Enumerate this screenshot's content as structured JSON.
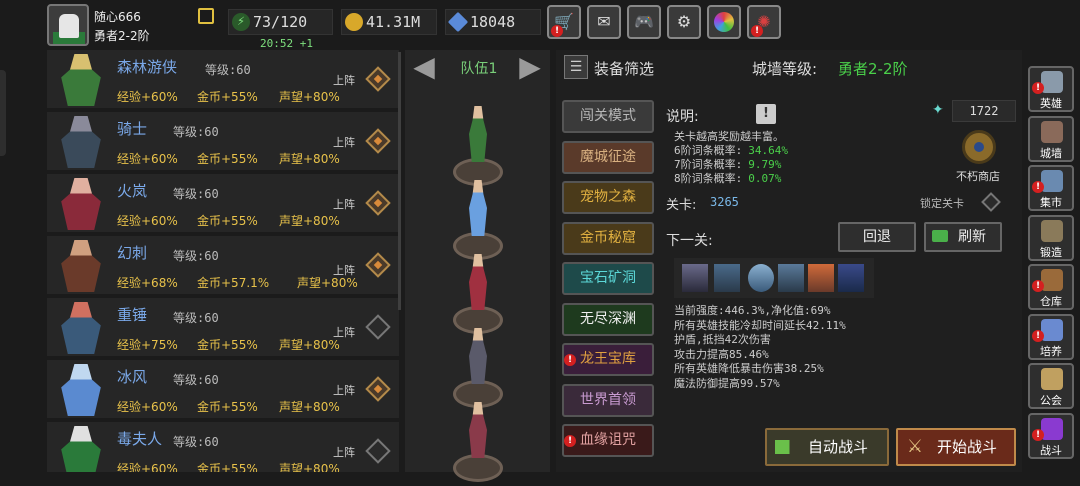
{
  "player": {
    "name": "随心666",
    "rank": "勇者2-2阶"
  },
  "resources": {
    "stamina": "73/120",
    "stamina_timer": "20:52 +1",
    "gold": "41.31M",
    "gems": "18048"
  },
  "colors": {
    "accent_green": "#4ad04a",
    "hero_name": "#7aa8e8",
    "bonus": "#e8c24a",
    "alert": "#d42020"
  },
  "top_icons": [
    "shop-cart-icon",
    "mail-icon",
    "gamepad-icon",
    "gear-icon",
    "color-wheel-icon",
    "firework-icon"
  ],
  "heroes": [
    {
      "name": "森林游侠",
      "level_label": "等级:60",
      "exp": "经验+60%",
      "gold": "金币+55%",
      "fame": "声望+80%",
      "deploy": "上阵",
      "selected": true
    },
    {
      "name": "骑士",
      "level_label": "等级:60",
      "exp": "经验+60%",
      "gold": "金币+55%",
      "fame": "声望+80%",
      "deploy": "上阵",
      "selected": true
    },
    {
      "name": "火岚",
      "level_label": "等级:60",
      "exp": "经验+60%",
      "gold": "金币+55%",
      "fame": "声望+80%",
      "deploy": "上阵",
      "selected": true
    },
    {
      "name": "幻刺",
      "level_label": "等级:60",
      "exp": "经验+68%",
      "gold": "金币+57.1%",
      "fame": "声望+80%",
      "deploy": "上阵",
      "selected": true
    },
    {
      "name": "重锤",
      "level_label": "等级:60",
      "exp": "经验+75%",
      "gold": "金币+55%",
      "fame": "声望+80%",
      "deploy": "上阵",
      "selected": false
    },
    {
      "name": "冰风",
      "level_label": "等级:60",
      "exp": "经验+60%",
      "gold": "金币+55%",
      "fame": "声望+80%",
      "deploy": "上阵",
      "selected": true
    },
    {
      "name": "毒夫人",
      "level_label": "等级:60",
      "exp": "经验+60%",
      "gold": "金币+55%",
      "fame": "声望+80%",
      "deploy": "上阵",
      "selected": false
    }
  ],
  "team": {
    "label": "队伍1"
  },
  "panel": {
    "filter_label": "装备筛选",
    "wall_label": "城墙等级:",
    "wall_value": "勇者2-2阶"
  },
  "modes": [
    {
      "label": "闯关模式",
      "style": "gray",
      "alert": false
    },
    {
      "label": "魔城征途",
      "style": "brown",
      "alert": false
    },
    {
      "label": "宠物之森",
      "style": "olive",
      "alert": false
    },
    {
      "label": "金币秘窟",
      "style": "olive",
      "alert": false
    },
    {
      "label": "宝石矿洞",
      "style": "teal",
      "alert": false
    },
    {
      "label": "无尽深渊",
      "style": "green",
      "alert": false
    },
    {
      "label": "龙王宝库",
      "style": "purple",
      "alert": true
    },
    {
      "label": "世界首领",
      "style": "violet",
      "alert": false
    },
    {
      "label": "血缘诅咒",
      "style": "red",
      "alert": true
    }
  ],
  "details": {
    "title": "说明:",
    "gem_count": "1722",
    "shop_label": "不朽商店",
    "desc": "关卡越高奖励越丰富。",
    "rates": [
      {
        "label": "6阶词条概率:",
        "value": "34.64%"
      },
      {
        "label": "7阶词条概率:",
        "value": "9.79%"
      },
      {
        "label": "8阶词条概率:",
        "value": "0.07%"
      }
    ],
    "stage_label": "关卡:",
    "stage_value": "3265",
    "lock_label": "锁定关卡",
    "next_label": "下一关:",
    "back_btn": "回退",
    "refresh_btn": "刷新",
    "effects": [
      "当前强度:446.3%,净化值:69%",
      "所有英雄技能冷却时间延长42.11%",
      "护盾,抵挡42次伤害",
      "攻击力提高85.46%",
      "所有英雄降低暴击伤害38.25%",
      "魔法防御提高99.57%"
    ],
    "auto_battle": "自动战斗",
    "start_battle": "开始战斗"
  },
  "sidebar": [
    {
      "label": "英雄",
      "icon": "helmet-icon",
      "alert": true
    },
    {
      "label": "城墙",
      "icon": "castle-icon",
      "alert": false
    },
    {
      "label": "集市",
      "icon": "market-icon",
      "alert": true
    },
    {
      "label": "锻造",
      "icon": "anvil-icon",
      "alert": false
    },
    {
      "label": "仓库",
      "icon": "chest-icon",
      "alert": true
    },
    {
      "label": "培养",
      "icon": "train-icon",
      "alert": true
    },
    {
      "label": "公会",
      "icon": "guild-icon",
      "alert": false
    },
    {
      "label": "战斗",
      "icon": "portal-icon",
      "alert": true
    }
  ]
}
